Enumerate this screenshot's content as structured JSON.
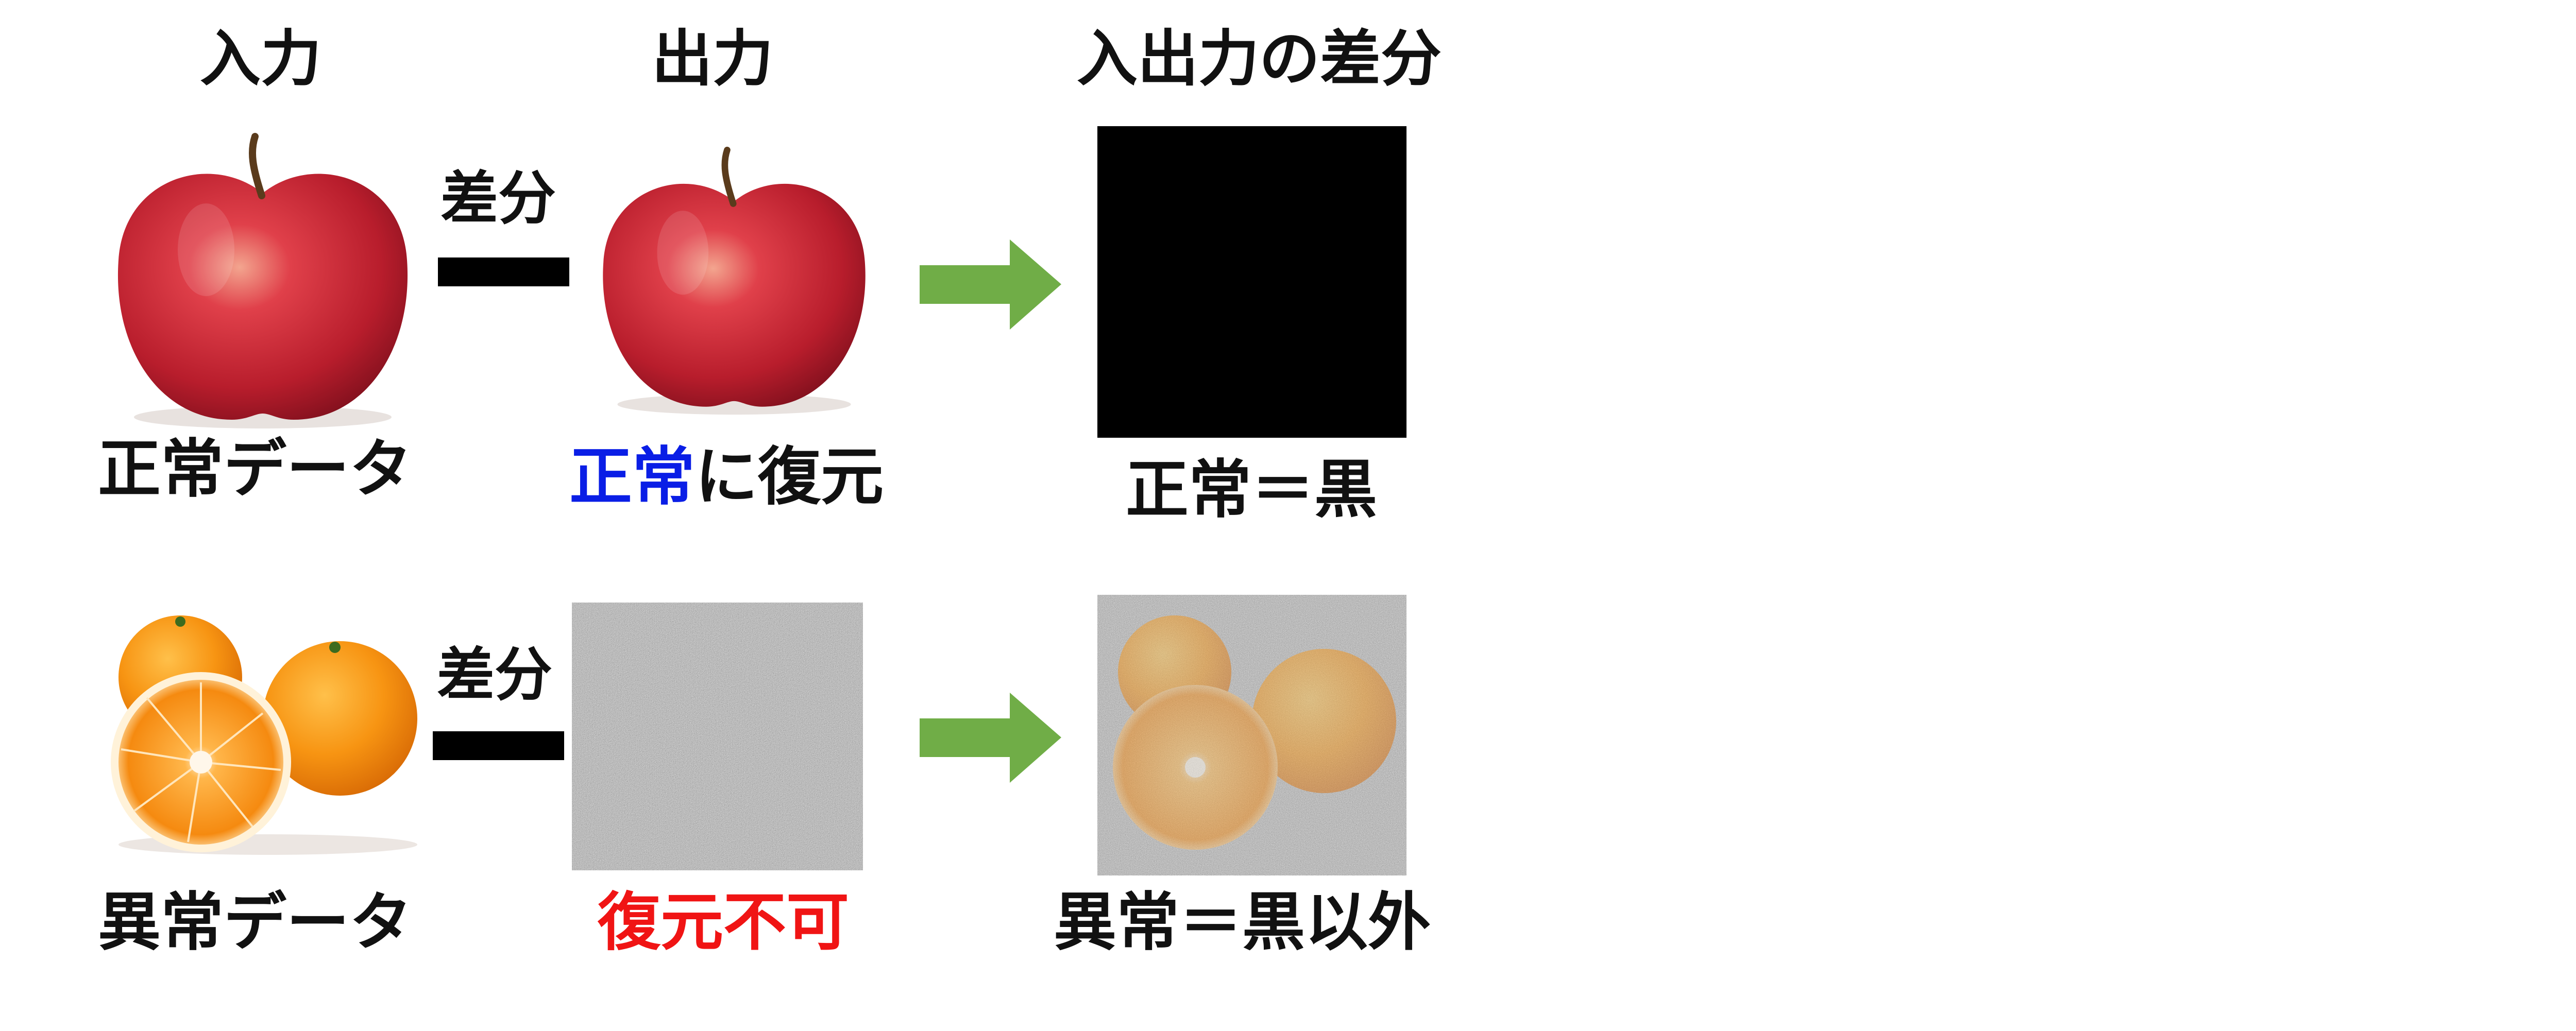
{
  "headers": {
    "input": "入力",
    "output": "出力",
    "difference": "入出力の差分"
  },
  "operator_label": "差分",
  "rows": {
    "normal": {
      "input_label": "正常データ",
      "output_label_highlight": "正常",
      "output_label_rest": "に復元",
      "diff_label": "正常＝黒",
      "input_icon": "apple-image",
      "output_icon": "apple-image",
      "diff_icon": "black-square"
    },
    "anomaly": {
      "input_label": "異常データ",
      "output_label": "復元不可",
      "diff_label": "異常＝黒以外",
      "input_icon": "mandarin-oranges-image",
      "output_icon": "gray-noise-image",
      "diff_icon": "noisy-oranges-image"
    }
  },
  "colors": {
    "highlight_blue": "#0a1ee6",
    "highlight_red": "#f01414",
    "arrow_green": "#70ad47",
    "text": "#111111"
  }
}
